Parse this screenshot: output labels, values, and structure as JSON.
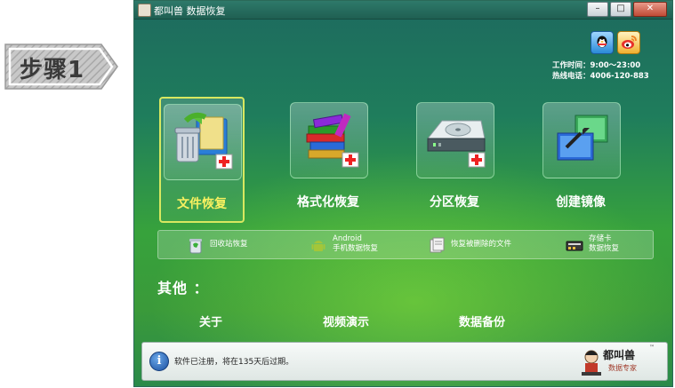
{
  "step_badge": {
    "text": "步骤1"
  },
  "window": {
    "title": "都叫兽 数据恢复",
    "controls": [
      "minimize",
      "maximize",
      "close"
    ]
  },
  "social": {
    "qq": "qq-icon",
    "weibo": "weibo-icon"
  },
  "contact": {
    "hours": "工作时间：9:00～23:00",
    "phone": "热线电话：4006-120-883"
  },
  "features": [
    {
      "label": "文件恢复",
      "selected": true,
      "icon": "recycle-folder-icon"
    },
    {
      "label": "格式化恢复",
      "selected": false,
      "icon": "books-icon"
    },
    {
      "label": "分区恢复",
      "selected": false,
      "icon": "hard-drive-icon"
    },
    {
      "label": "创建镜像",
      "selected": false,
      "icon": "image-copy-icon"
    }
  ],
  "sub_features": [
    {
      "line1": "回收站恢复",
      "line2": "",
      "icon": "recycle-bin-icon"
    },
    {
      "line1": "Android",
      "line2": "手机数据恢复",
      "icon": "android-icon"
    },
    {
      "line1": "恢复被删除的文件",
      "line2": "",
      "icon": "deleted-file-icon"
    },
    {
      "line1": "存储卡",
      "line2": "数据恢复",
      "icon": "memory-card-icon"
    }
  ],
  "others": {
    "title": "其他 ：",
    "links": [
      "关于",
      "视频演示",
      "数据备份"
    ]
  },
  "status": {
    "text": "软件已注册，将在135天后过期。",
    "brand_name": "都叫兽",
    "brand_sub": "数据专家",
    "brand_tm": "™"
  },
  "colors": {
    "selected_label": "#f8f060",
    "selected_border": "#d8e860",
    "window_bg_top": "#1d6a5e",
    "window_bg_glow": "#8ce63c"
  }
}
